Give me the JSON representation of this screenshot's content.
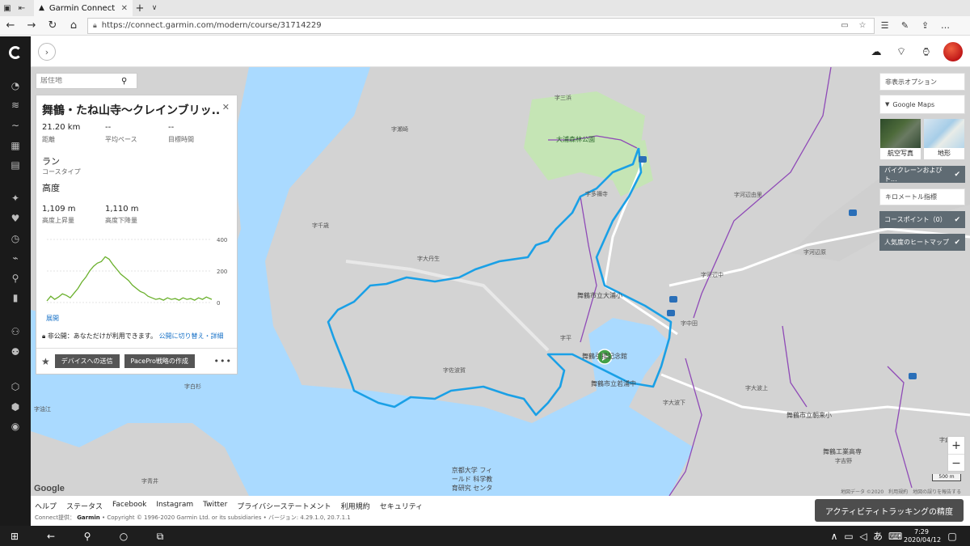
{
  "browser": {
    "tab_title": "Garmin Connect",
    "tab_close": "✕",
    "url": "https://connect.garmin.com/modern/course/31714229"
  },
  "search": {
    "placeholder": "居住地"
  },
  "course": {
    "title": "舞鶴・たね山寺〜クレインブリッ...",
    "distance_value": "21.20 km",
    "distance_label": "距離",
    "avg_pace_value": "--",
    "avg_pace_label": "平均ペース",
    "target_time_value": "--",
    "target_time_label": "目標時間",
    "course_type_value": "ラン",
    "course_type_label": "コースタイプ",
    "elevation_heading": "高度",
    "ascent_value": "1,109 m",
    "ascent_label": "高度上昇量",
    "descent_value": "1,110 m",
    "descent_label": "高度下降量",
    "expand_link": "展開",
    "privacy_text": "非公開：あなただけが利用できます。",
    "privacy_link": "公開に切り替え・詳細",
    "send_device_btn": "デバイスへの送信",
    "pacepro_btn": "PacePro戦略の作成",
    "more": "•••"
  },
  "chart_data": {
    "type": "area",
    "title": "",
    "xlabel": "",
    "ylabel": "",
    "ylim": [
      0,
      400
    ],
    "yticks": [
      "400",
      "200",
      "0"
    ],
    "series": [
      {
        "x": [
          0,
          0.5,
          1,
          1.5,
          2,
          2.5,
          3,
          3.5,
          4,
          4.5,
          5,
          5.5,
          6,
          6.5,
          7,
          7.5,
          8,
          8.5,
          9,
          9.5,
          10,
          10.5,
          11,
          11.5,
          12,
          12.5,
          13,
          13.5,
          14,
          14.5,
          15,
          15.5,
          16,
          16.5,
          17,
          17.5,
          18,
          18.5,
          19,
          19.5,
          20,
          20.5,
          21.2
        ],
        "values": [
          10,
          40,
          20,
          35,
          55,
          45,
          30,
          60,
          90,
          130,
          160,
          200,
          230,
          250,
          260,
          290,
          275,
          240,
          210,
          180,
          160,
          140,
          110,
          90,
          70,
          60,
          40,
          30,
          20,
          25,
          15,
          30,
          20,
          25,
          15,
          30,
          20,
          25,
          15,
          30,
          20,
          35,
          20
        ]
      }
    ]
  },
  "right_panel": {
    "hide_options": "非表示オプション",
    "google_maps": "Google Maps",
    "aerial": "航空写真",
    "terrain": "地形",
    "bike_lanes": "バイクレーンおよびト...",
    "km_markers": "キロメートル指標",
    "course_points": "コースポイント（0）",
    "heatmap": "人気度のヒートマップ",
    "check": "✔"
  },
  "map": {
    "labels": {
      "l1": "字三浜",
      "l2": "大浦森林公園",
      "l3": "字瀬崎",
      "l4": "字千歳",
      "l5": "字大丹生",
      "l6": "字佐波賀",
      "l7": "字河辺由里",
      "l8": "字河辺原",
      "l9": "字河辺中",
      "l10": "舞鶴市立大浦小",
      "l11": "字中田",
      "l12": "字平",
      "l13": "舞鶴引揚記念館",
      "l14": "舞鶴市立若浦中",
      "l15": "字大波上",
      "l16": "字大波下",
      "l17": "舞鶴市立朝来小",
      "l18": "字倉谷",
      "l19": "舞鶴工業高専",
      "l20": "字吉野",
      "l21": "京都大学 フィールド 科学教育研究 センター",
      "l22": "字白杉",
      "l23": "字油江",
      "l24": "字青井",
      "l25": "字多禰寺"
    },
    "google": "Google",
    "attribution": "地図データ ©2020　利用規約　地図の誤りを報告する",
    "scale": "500 m",
    "zoom_in": "+",
    "zoom_out": "−"
  },
  "footer": {
    "links": [
      "ヘルプ",
      "ステータス",
      "Facebook",
      "Instagram",
      "Twitter",
      "プライバシーステートメント",
      "利用規約",
      "セキュリティ"
    ],
    "copyright_prefix": "Connect提供：",
    "garmin": "Garmin",
    "copyright_rest": "• Copyright © 1996-2020 Garmin Ltd. or its subsidiaries • バージョン: 4.29.1.0, 20.7.1.1",
    "activity_button": "アクティビティトラッキングの精度"
  },
  "taskbar": {
    "time": "7:29",
    "date": "2020/04/12"
  },
  "colors": {
    "route": "#1aa0e6",
    "elevation": "#6ab02c",
    "sidebar": "#1a1a1a",
    "dark_toggle": "#5f6b73"
  }
}
